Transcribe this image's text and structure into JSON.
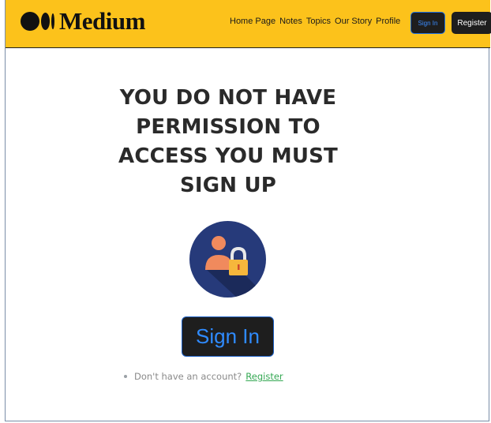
{
  "brand": {
    "name": "Medium"
  },
  "nav": {
    "links": [
      "Home Page",
      "Notes",
      "Topics",
      "Our Story",
      "Profile"
    ],
    "sign_in": "Sign In",
    "register": "Register"
  },
  "main": {
    "heading_lines": [
      "YOU DO NOT HAVE",
      "PERMISSION TO",
      "ACCESS YOU MUST",
      "SIGN UP"
    ],
    "icon": "user-lock-icon",
    "sign_in_button": "Sign In",
    "account_prompt": "Don't have an account?",
    "register_link": "Register"
  },
  "colors": {
    "navbar": "#fcc21b",
    "button_bg": "#1e1e1e",
    "button_text": "#2f8bff",
    "link": "#34a853",
    "icon_circle": "#263a7a"
  }
}
